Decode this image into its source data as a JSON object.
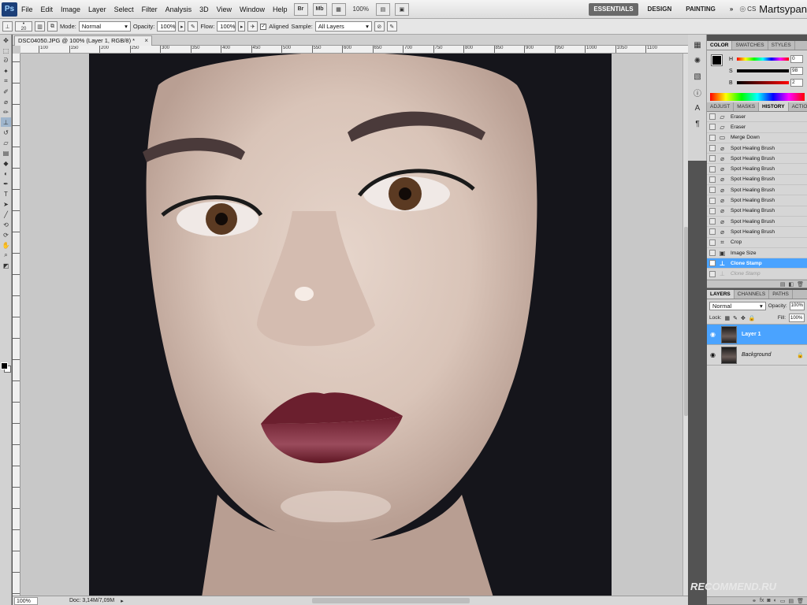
{
  "menubar": {
    "logo": "Ps",
    "items": [
      "File",
      "Edit",
      "Image",
      "Layer",
      "Select",
      "Filter",
      "Analysis",
      "3D",
      "View",
      "Window",
      "Help"
    ],
    "bridge_label": "Br",
    "minibridge_label": "Mb",
    "zoom": "100%",
    "workspaces": {
      "essentials": "ESSENTIALS",
      "design": "DESIGN",
      "painting": "PAINTING"
    },
    "more": "»",
    "cs_live": "CS",
    "user": "Martsypan"
  },
  "options": {
    "brush_size": "20",
    "mode_label": "Mode:",
    "mode_value": "Normal",
    "opacity_label": "Opacity:",
    "opacity_value": "100%",
    "flow_label": "Flow:",
    "flow_value": "100%",
    "aligned_label": "Aligned",
    "sample_label": "Sample:",
    "sample_value": "All Layers"
  },
  "document": {
    "tab_title": "DSC04050.JPG @ 100% (Layer 1, RGB/8) *",
    "ruler_ticks": [
      "100",
      "150",
      "200",
      "250",
      "300",
      "350",
      "400",
      "450",
      "500",
      "550",
      "600",
      "650",
      "700",
      "750",
      "800",
      "850",
      "900",
      "950",
      "1000",
      "1050",
      "1100"
    ],
    "status_zoom": "100%",
    "status_doc": "Doc: 3,14M/7,09M"
  },
  "color_panel": {
    "tabs": [
      "COLOR",
      "SWATCHES",
      "STYLES"
    ],
    "h_label": "H",
    "h_value": "0",
    "s_label": "S",
    "s_value": "98",
    "b_label": "B",
    "b_value": "2"
  },
  "history_panel": {
    "tabs": [
      "ADJUST",
      "MASKS",
      "HISTORY",
      "ACTION"
    ],
    "items": [
      "Eraser",
      "Eraser",
      "Merge Down",
      "Spot Healing Brush",
      "Spot Healing Brush",
      "Spot Healing Brush",
      "Spot Healing Brush",
      "Spot Healing Brush",
      "Spot Healing Brush",
      "Spot Healing Brush",
      "Spot Healing Brush",
      "Spot Healing Brush",
      "Crop",
      "Image Size",
      "Clone Stamp",
      "Clone Stamp"
    ]
  },
  "layers_panel": {
    "tabs": [
      "LAYERS",
      "CHANNELS",
      "PATHS"
    ],
    "blend_mode": "Normal",
    "opacity_label": "Opacity:",
    "opacity_value": "100%",
    "lock_label": "Lock:",
    "fill_label": "Fill:",
    "fill_value": "100%",
    "layers": [
      "Layer 1",
      "Background"
    ]
  },
  "watermark": "RECOMMEND.RU",
  "colors": {
    "accent": "#4aa3ff",
    "chrome": "#535353",
    "foreground": "#000000"
  }
}
